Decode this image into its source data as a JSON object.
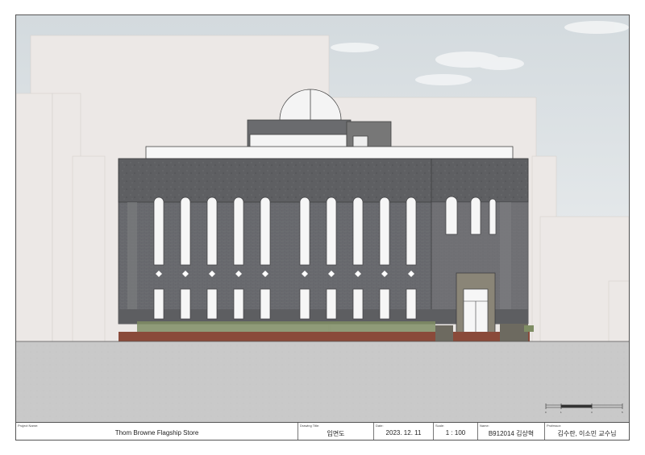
{
  "sheet": {
    "project_label": "Project Name:",
    "project_name": "Thom Browne Flagship Store",
    "drawing_title_label": "Drawing Title:",
    "drawing_title": "입면도",
    "date_label": "Date:",
    "date": "2023. 12. 11",
    "scale_label": "Scale:",
    "scale": "1 : 100",
    "name_label": "Name:",
    "name": "B912014 김상혁",
    "professor_label": "Professor:",
    "professor": "김수란, 이소민 교수님"
  },
  "scale_bar": {
    "ticks": [
      "0",
      "1",
      "3",
      "5"
    ]
  },
  "colors": {
    "sky": "#dfe3e6",
    "background_buildings": "#ece8e6",
    "brick_wall": "#6e6f72",
    "cornice": "#5c5d60",
    "ground": "#c9c9c9",
    "planter_green": "#7f8d64",
    "planter_brick": "#8a4a3a"
  }
}
